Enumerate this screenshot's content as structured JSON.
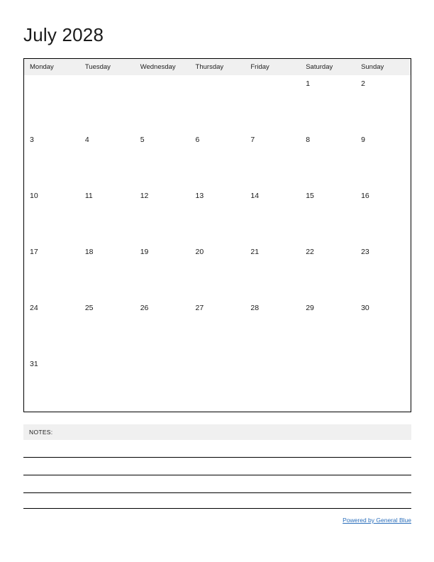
{
  "document": {
    "title": "July 2028",
    "month": "July",
    "year": "2028"
  },
  "calendar": {
    "weekday_headers": [
      "Monday",
      "Tuesday",
      "Wednesday",
      "Thursday",
      "Friday",
      "Saturday",
      "Sunday"
    ],
    "weeks": [
      [
        "",
        "",
        "",
        "",
        "",
        "1",
        "2"
      ],
      [
        "3",
        "4",
        "5",
        "6",
        "7",
        "8",
        "9"
      ],
      [
        "10",
        "11",
        "12",
        "13",
        "14",
        "15",
        "16"
      ],
      [
        "17",
        "18",
        "19",
        "20",
        "21",
        "22",
        "23"
      ],
      [
        "24",
        "25",
        "26",
        "27",
        "28",
        "29",
        "30"
      ],
      [
        "31",
        "",
        "",
        "",
        "",
        "",
        ""
      ]
    ]
  },
  "notes": {
    "label": "NOTES:",
    "line_count": 4
  },
  "footer": {
    "link_text": "Powered by General Blue"
  },
  "colors": {
    "header_band": "#f0f0f0",
    "grid_border": "#000000",
    "link": "#2a6ebb",
    "text": "#1a1a1a",
    "page_background": "#ffffff"
  }
}
